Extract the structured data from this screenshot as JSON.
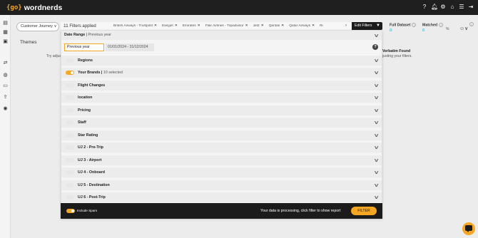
{
  "app": {
    "logo_mark": "{go}",
    "name": "wordnerds"
  },
  "header_icons": [
    "help-icon",
    "bell-icon",
    "settings-icon",
    "home-icon",
    "sliders-icon",
    "logout-icon"
  ],
  "sidebar_icons": [
    "chart-icon",
    "table-icon",
    "grid-icon",
    "filters-icon",
    "alert-icon",
    "comments-icon",
    "upload-icon",
    "bell-icon"
  ],
  "journey": {
    "label": "Customer Journey"
  },
  "filterbar": {
    "count": "11",
    "count_text": "Filters applied",
    "chips": [
      "British Airways - Trustpilot",
      "Easyjet",
      "Emirates",
      "Flair Airlines - Tripadvisor",
      "Jet2",
      "Qantas",
      "Qatar Airways",
      "Ri"
    ],
    "edit_label": "Edit Filters"
  },
  "stats": {
    "full_label": "Full Dataset",
    "full_value": "0",
    "matched_label": "Matched",
    "matched_value": "0",
    "pct": "%"
  },
  "background": {
    "themes": "Themes",
    "try_adjust": "Try adjus",
    "no_verbatim": "Verbatim Found",
    "adjust_rest": "justing your filters."
  },
  "panel": {
    "date_range": {
      "title": "Date Range",
      "value": "Previous year",
      "period": "Previous year",
      "dates": "01/01/2024 - 31/12/2024"
    },
    "rows": [
      {
        "label": "Regions",
        "sub": "",
        "on": false
      },
      {
        "label": "Your Brands",
        "sub": "10 selected",
        "on": true
      },
      {
        "label": "Flight Changes",
        "sub": "",
        "on": false
      },
      {
        "label": "location",
        "sub": "",
        "on": false
      },
      {
        "label": "Pricing",
        "sub": "",
        "on": false
      },
      {
        "label": "Staff",
        "sub": "",
        "on": false
      },
      {
        "label": "Star Rating",
        "sub": "",
        "on": false
      },
      {
        "label": "UJ 2 - Pre-Trip",
        "sub": "",
        "on": false
      },
      {
        "label": "UJ 3 - Airport",
        "sub": "",
        "on": false
      },
      {
        "label": "UJ 4 - Onboard",
        "sub": "",
        "on": false
      },
      {
        "label": "UJ 5 - Destination",
        "sub": "",
        "on": false
      },
      {
        "label": "UJ 6 - Post-Trip",
        "sub": "",
        "on": false
      }
    ]
  },
  "bottom": {
    "spam_label": "Include Spam",
    "processing": "Your data is processing, click filter to show report",
    "filter_button": "FILTER"
  },
  "colors": {
    "accent": "#f5a623",
    "dark": "#1b1b1b",
    "teal": "#1aa3b8"
  }
}
